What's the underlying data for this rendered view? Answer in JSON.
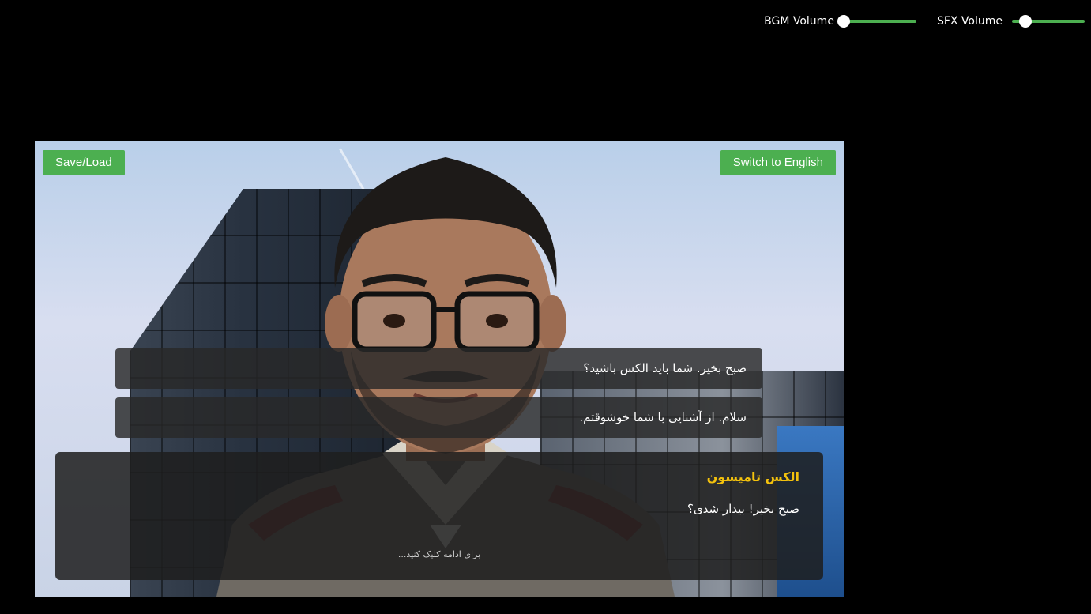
{
  "audio": {
    "bgm_label": "BGM Volume",
    "bgm_value": 0.0,
    "sfx_label": "SFX Volume",
    "sfx_value": 0.18
  },
  "toolbar": {
    "save_load_label": "Save/Load",
    "switch_language_label": "Switch to English"
  },
  "choices": [
    {
      "text": "صبح بخیر. شما باید الکس باشید؟"
    },
    {
      "text": "سلام. از آشنایی با شما خوشوقتم."
    }
  ],
  "dialog": {
    "speaker": "الکس تامپسون",
    "text": "صبح بخیر! بیدار شدی؟",
    "continue_hint": "برای ادامه کلیک کنید..."
  },
  "colors": {
    "accent": "#4caf50",
    "speaker": "#f4c20d",
    "background": "#000000"
  }
}
